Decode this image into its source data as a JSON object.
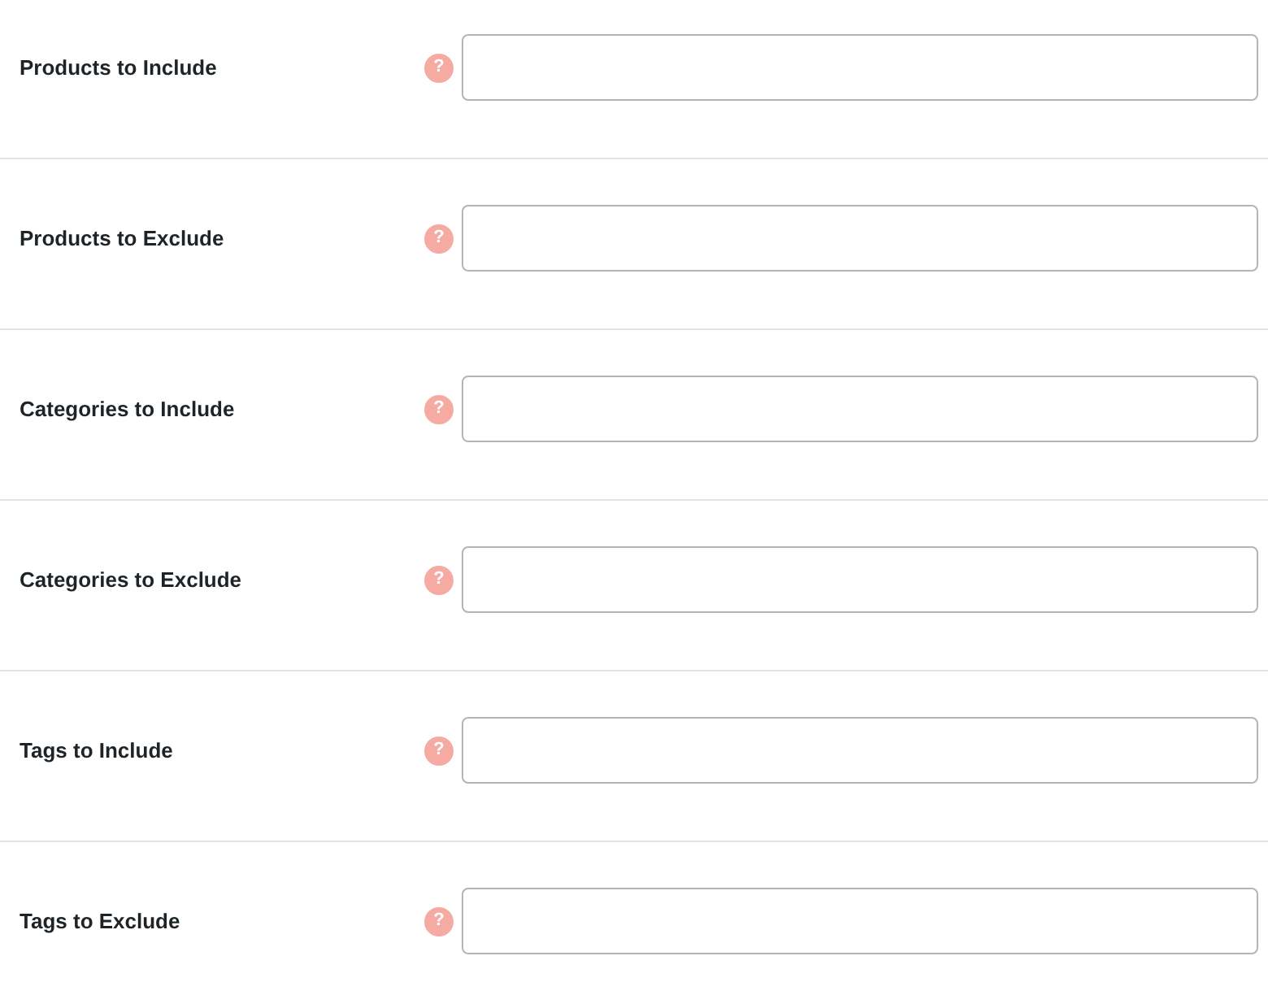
{
  "fields": [
    {
      "label": "Products to Include",
      "help": "?"
    },
    {
      "label": "Products to Exclude",
      "help": "?"
    },
    {
      "label": "Categories to Include",
      "help": "?"
    },
    {
      "label": "Categories to Exclude",
      "help": "?"
    },
    {
      "label": "Tags to Include",
      "help": "?"
    },
    {
      "label": "Tags to Exclude",
      "help": "?"
    }
  ]
}
